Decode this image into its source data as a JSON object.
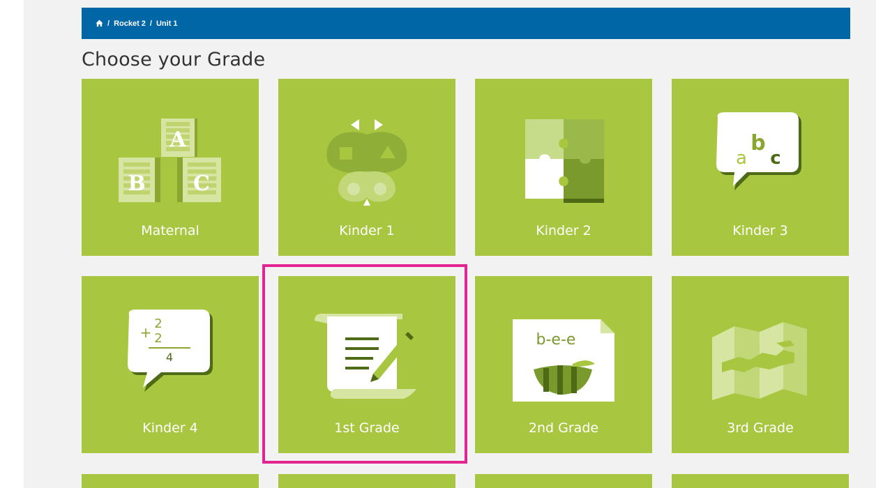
{
  "breadcrumb": {
    "home_icon": "home-icon",
    "separator": "/",
    "items": [
      "Rocket 2",
      "Unit 1"
    ]
  },
  "page_title": "Choose your Grade",
  "colors": {
    "header_bg": "#0066a6",
    "tile_bg": "#a8c63f",
    "highlight": "#e3238f"
  },
  "grades": [
    {
      "label": "Maternal",
      "icon": "abc-blocks-icon"
    },
    {
      "label": "Kinder 1",
      "icon": "butterfly-shapes-icon"
    },
    {
      "label": "Kinder 2",
      "icon": "puzzle-icon"
    },
    {
      "label": "Kinder 3",
      "icon": "abc-speech-bubble-icon"
    },
    {
      "label": "Kinder 4",
      "icon": "math-speech-bubble-icon"
    },
    {
      "label": "1st Grade",
      "icon": "scroll-pencil-icon"
    },
    {
      "label": "2nd Grade",
      "icon": "bee-spelling-icon"
    },
    {
      "label": "3rd Grade",
      "icon": "folded-map-icon"
    }
  ],
  "bubble_text": {
    "a": "a",
    "b": "b",
    "c": "c",
    "plus": "+",
    "n1": "2",
    "n2": "2",
    "sum": "4"
  },
  "block_letters": {
    "a": "A",
    "b": "B",
    "c": "C"
  },
  "bee_word": "b-e-e"
}
